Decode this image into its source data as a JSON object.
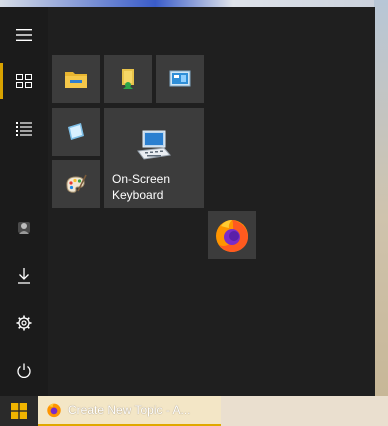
{
  "start_menu": {
    "rail": [
      {
        "icon": "hamburger-icon",
        "label": "Expand"
      },
      {
        "icon": "tiles-icon",
        "label": "Pinned tiles"
      },
      {
        "icon": "all-apps-list-icon",
        "label": "All apps"
      },
      {
        "icon": "user-avatar-icon",
        "label": "Account"
      },
      {
        "icon": "downloads-icon",
        "label": "Downloads"
      },
      {
        "icon": "settings-gear-icon",
        "label": "Settings"
      },
      {
        "icon": "power-icon",
        "label": "Power"
      }
    ],
    "tiles": [
      {
        "icon": "file-explorer-icon"
      },
      {
        "icon": "user-folder-icon"
      },
      {
        "icon": "control-panel-icon"
      },
      {
        "icon": "notepad-icon"
      },
      {
        "icon": "on-screen-keyboard-icon",
        "label_line1": "On-Screen",
        "label_line2": "Keyboard"
      },
      {
        "icon": "paint-icon"
      },
      {
        "icon": "firefox-icon"
      }
    ]
  },
  "taskbar": {
    "start_icon": "windows-logo-icon",
    "items": [
      {
        "icon": "firefox-icon",
        "label": "Create New Topic - A..."
      }
    ]
  },
  "colors": {
    "accent": "#d8a200",
    "menu_bg": "#1f1f1f",
    "tile_bg": "#3c3c3c"
  }
}
